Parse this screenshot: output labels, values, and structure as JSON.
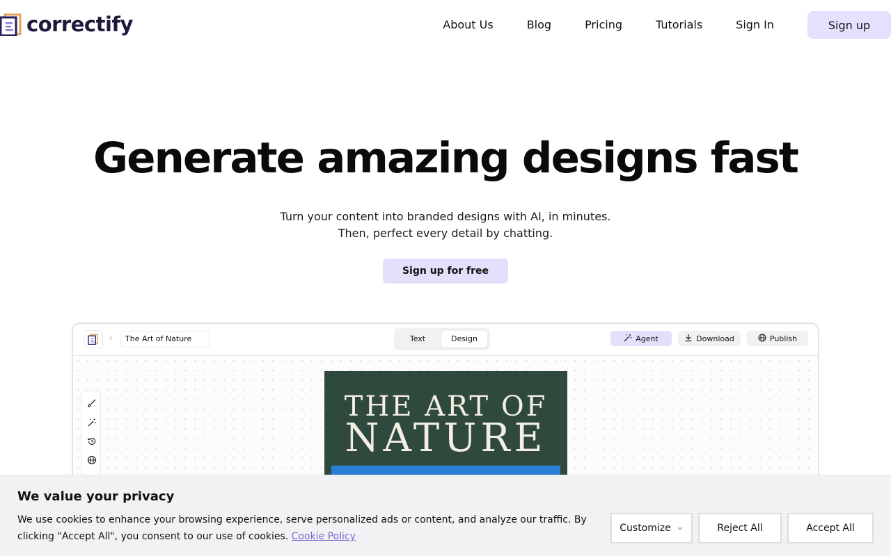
{
  "header": {
    "logo_text": "correctify",
    "nav": [
      "About Us",
      "Blog",
      "Pricing",
      "Tutorials",
      "Sign In"
    ],
    "signup_label": "Sign up",
    "accent_color": "#e6e0ff"
  },
  "hero": {
    "title": "Generate amazing designs fast",
    "subtitle_line1": "Turn your content into branded designs with AI, in minutes.",
    "subtitle_line2": "Then, perfect every detail by chatting.",
    "cta_label": "Sign up for free"
  },
  "preview": {
    "doc_title": "The Art of Nature",
    "toggle": {
      "text_label": "Text",
      "design_label": "Design",
      "selected": "Design"
    },
    "buttons": {
      "agent_label": "Agent",
      "download_label": "Download",
      "publish_label": "Publish"
    },
    "side_tools": [
      "brush-icon",
      "magic-wand-icon",
      "history-icon",
      "globe-icon"
    ],
    "cover": {
      "line1": "THE ART OF",
      "line2": "NATURE",
      "bg_color": "#2f4a3c",
      "image_color": "#2a7fd8"
    }
  },
  "cookie": {
    "title": "We value your privacy",
    "text": "We use cookies to enhance your browsing experience, serve personalized ads or content, and analyze our traffic. By clicking \"Accept All\", you consent to our use of cookies.",
    "policy_link": "Cookie Policy",
    "customize_label": "Customize",
    "reject_label": "Reject All",
    "accept_label": "Accept All"
  }
}
